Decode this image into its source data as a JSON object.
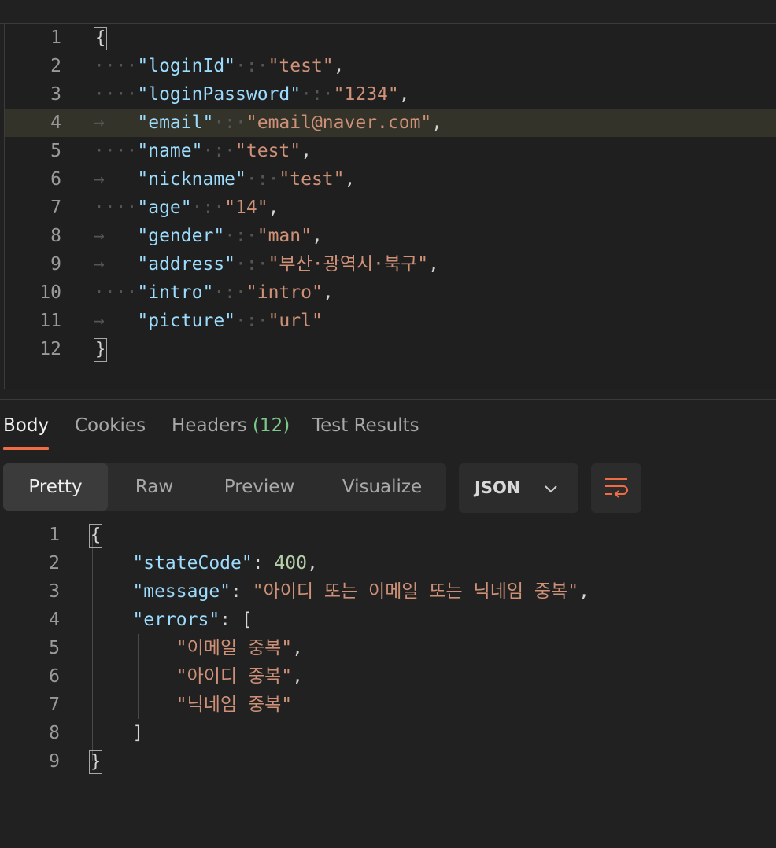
{
  "request_body": {
    "lines": [
      {
        "num": "1",
        "indent": "",
        "key": "",
        "sep": "",
        "value": "",
        "brace": "{",
        "comma": ""
      },
      {
        "num": "2",
        "indent": "····",
        "key": "\"loginId\"",
        "sep": "·:·",
        "value": "\"test\"",
        "brace": "",
        "comma": ","
      },
      {
        "num": "3",
        "indent": "····",
        "key": "\"loginPassword\"",
        "sep": "·:·",
        "value": "\"1234\"",
        "brace": "",
        "comma": ","
      },
      {
        "num": "4",
        "indent": "→   ",
        "key": "\"email\"",
        "sep": "·:·",
        "value": "\"email@naver.com\"",
        "brace": "",
        "comma": ","
      },
      {
        "num": "5",
        "indent": "····",
        "key": "\"name\"",
        "sep": "·:·",
        "value": "\"test\"",
        "brace": "",
        "comma": ","
      },
      {
        "num": "6",
        "indent": "→   ",
        "key": "\"nickname\"",
        "sep": "·:·",
        "value": "\"test\"",
        "brace": "",
        "comma": ","
      },
      {
        "num": "7",
        "indent": "····",
        "key": "\"age\"",
        "sep": "·:·",
        "value": "\"14\"",
        "brace": "",
        "comma": ","
      },
      {
        "num": "8",
        "indent": "→   ",
        "key": "\"gender\"",
        "sep": "·:·",
        "value": "\"man\"",
        "brace": "",
        "comma": ","
      },
      {
        "num": "9",
        "indent": "→   ",
        "key": "\"address\"",
        "sep": "·:·",
        "value": "\"부산·광역시·북구\"",
        "brace": "",
        "comma": ","
      },
      {
        "num": "10",
        "indent": "····",
        "key": "\"intro\"",
        "sep": "·:·",
        "value": "\"intro\"",
        "brace": "",
        "comma": ","
      },
      {
        "num": "11",
        "indent": "→   ",
        "key": "\"picture\"",
        "sep": "·:·",
        "value": "\"url\"",
        "brace": "",
        "comma": ""
      },
      {
        "num": "12",
        "indent": "",
        "key": "",
        "sep": "",
        "value": "",
        "brace": "}",
        "comma": ""
      }
    ]
  },
  "response_tabs": {
    "body": "Body",
    "cookies": "Cookies",
    "headers": "Headers",
    "headers_count": "(12)",
    "test_results": "Test Results"
  },
  "view_modes": {
    "pretty": "Pretty",
    "raw": "Raw",
    "preview": "Preview",
    "visualize": "Visualize"
  },
  "format": {
    "selected": "JSON"
  },
  "response_body": {
    "lines": [
      {
        "num": "1",
        "parts": [
          {
            "cls": "brace",
            "text": "{"
          }
        ]
      },
      {
        "num": "2",
        "parts": [
          {
            "cls": "sp",
            "text": "    "
          },
          {
            "cls": "key",
            "text": "\"stateCode\""
          },
          {
            "cls": "punc",
            "text": ": "
          },
          {
            "cls": "num",
            "text": "400"
          },
          {
            "cls": "punc",
            "text": ","
          }
        ]
      },
      {
        "num": "3",
        "parts": [
          {
            "cls": "sp",
            "text": "    "
          },
          {
            "cls": "key",
            "text": "\"message\""
          },
          {
            "cls": "punc",
            "text": ": "
          },
          {
            "cls": "str",
            "text": "\"아이디 또는 이메일 또는 닉네임 중복\""
          },
          {
            "cls": "punc",
            "text": ","
          }
        ]
      },
      {
        "num": "4",
        "parts": [
          {
            "cls": "sp",
            "text": "    "
          },
          {
            "cls": "key",
            "text": "\"errors\""
          },
          {
            "cls": "punc",
            "text": ": ["
          }
        ]
      },
      {
        "num": "5",
        "parts": [
          {
            "cls": "sp",
            "text": "        "
          },
          {
            "cls": "str",
            "text": "\"이메일 중복\""
          },
          {
            "cls": "punc",
            "text": ","
          }
        ]
      },
      {
        "num": "6",
        "parts": [
          {
            "cls": "sp",
            "text": "        "
          },
          {
            "cls": "str",
            "text": "\"아이디 중복\""
          },
          {
            "cls": "punc",
            "text": ","
          }
        ]
      },
      {
        "num": "7",
        "parts": [
          {
            "cls": "sp",
            "text": "        "
          },
          {
            "cls": "str",
            "text": "\"닉네임 중복\""
          }
        ]
      },
      {
        "num": "8",
        "parts": [
          {
            "cls": "sp",
            "text": "    "
          },
          {
            "cls": "punc",
            "text": "]"
          }
        ]
      },
      {
        "num": "9",
        "parts": [
          {
            "cls": "brace",
            "text": "}"
          }
        ]
      }
    ]
  },
  "colors": {
    "accent": "#ef6c45",
    "count": "#7dc98a",
    "key": "#9cdcfe",
    "string": "#ce9178",
    "number": "#b5cea8"
  },
  "icons": {
    "format_dropdown": "chevron-down-icon",
    "wrap": "wrap-lines-icon"
  }
}
